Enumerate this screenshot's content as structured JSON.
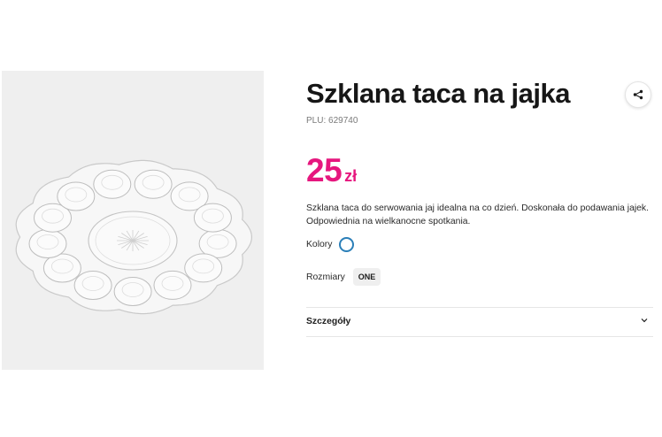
{
  "product": {
    "title": "Szklana taca na jajka",
    "plu": "PLU: 629740",
    "price": {
      "amount": "25",
      "currency": "zł",
      "color": "#e6177e"
    },
    "description": "Szklana taca do serwowania jaj idealna na co dzień. Doskonała do podawania jajek. Odpowiednia na wielkanocne spotkania."
  },
  "colors": {
    "label": "Kolory",
    "selected_swatch_color": "#2b7fb8"
  },
  "sizes": {
    "label": "Rozmiary",
    "options": [
      "ONE"
    ]
  },
  "details": {
    "label": "Szczegóły"
  },
  "icons": {
    "share": "share-icon",
    "expand": "chevron-down-icon"
  }
}
